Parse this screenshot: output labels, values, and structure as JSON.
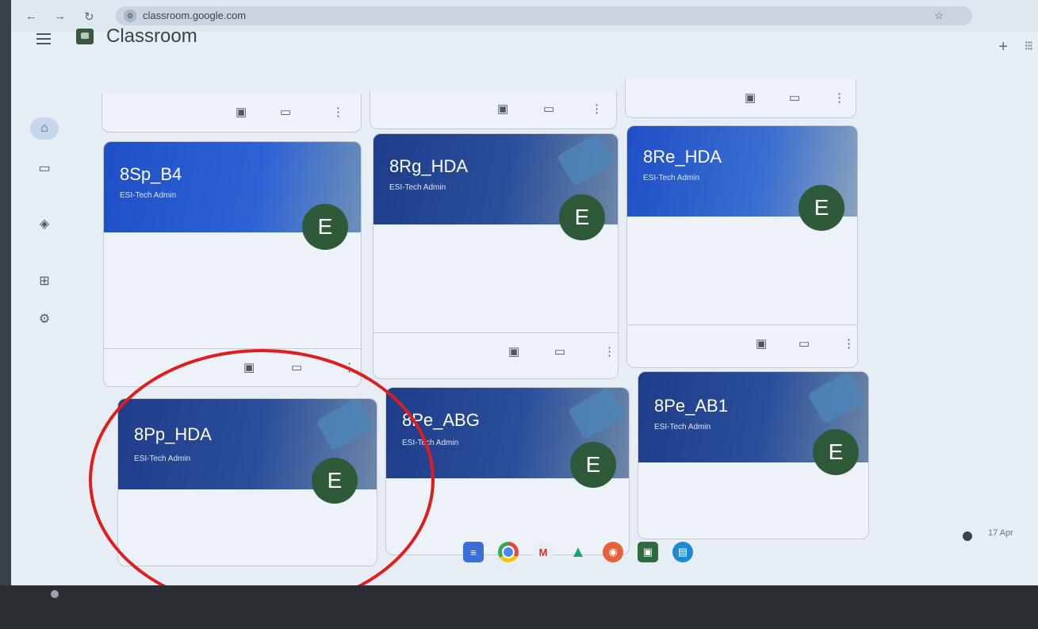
{
  "browser": {
    "url": "classroom.google.com",
    "back_icon": "arrow-left-icon",
    "forward_icon": "arrow-right-icon",
    "reload_icon": "reload-icon"
  },
  "app": {
    "title": "Classroom"
  },
  "classes": [
    {
      "name": "8Sp_B4",
      "owner": "ESI-Tech Admin",
      "avatar": "E"
    },
    {
      "name": "8Rg_HDA",
      "owner": "ESI-Tech Admin",
      "avatar": "E"
    },
    {
      "name": "8Re_HDA",
      "owner": "ESI-Tech Admin",
      "avatar": "E"
    },
    {
      "name": "8Pp_HDA",
      "owner": "ESI-Tech Admin",
      "avatar": "E"
    },
    {
      "name": "8Pe_ABG",
      "owner": "ESI-Tech Admin",
      "avatar": "E"
    },
    {
      "name": "8Pe_AB1",
      "owner": "ESI-Tech Admin",
      "avatar": "E"
    }
  ],
  "system": {
    "date": "17 Apr"
  },
  "colors": {
    "card_header": "#2d63d6",
    "avatar": "#2f5a3a",
    "highlight": "#e11c1c"
  }
}
